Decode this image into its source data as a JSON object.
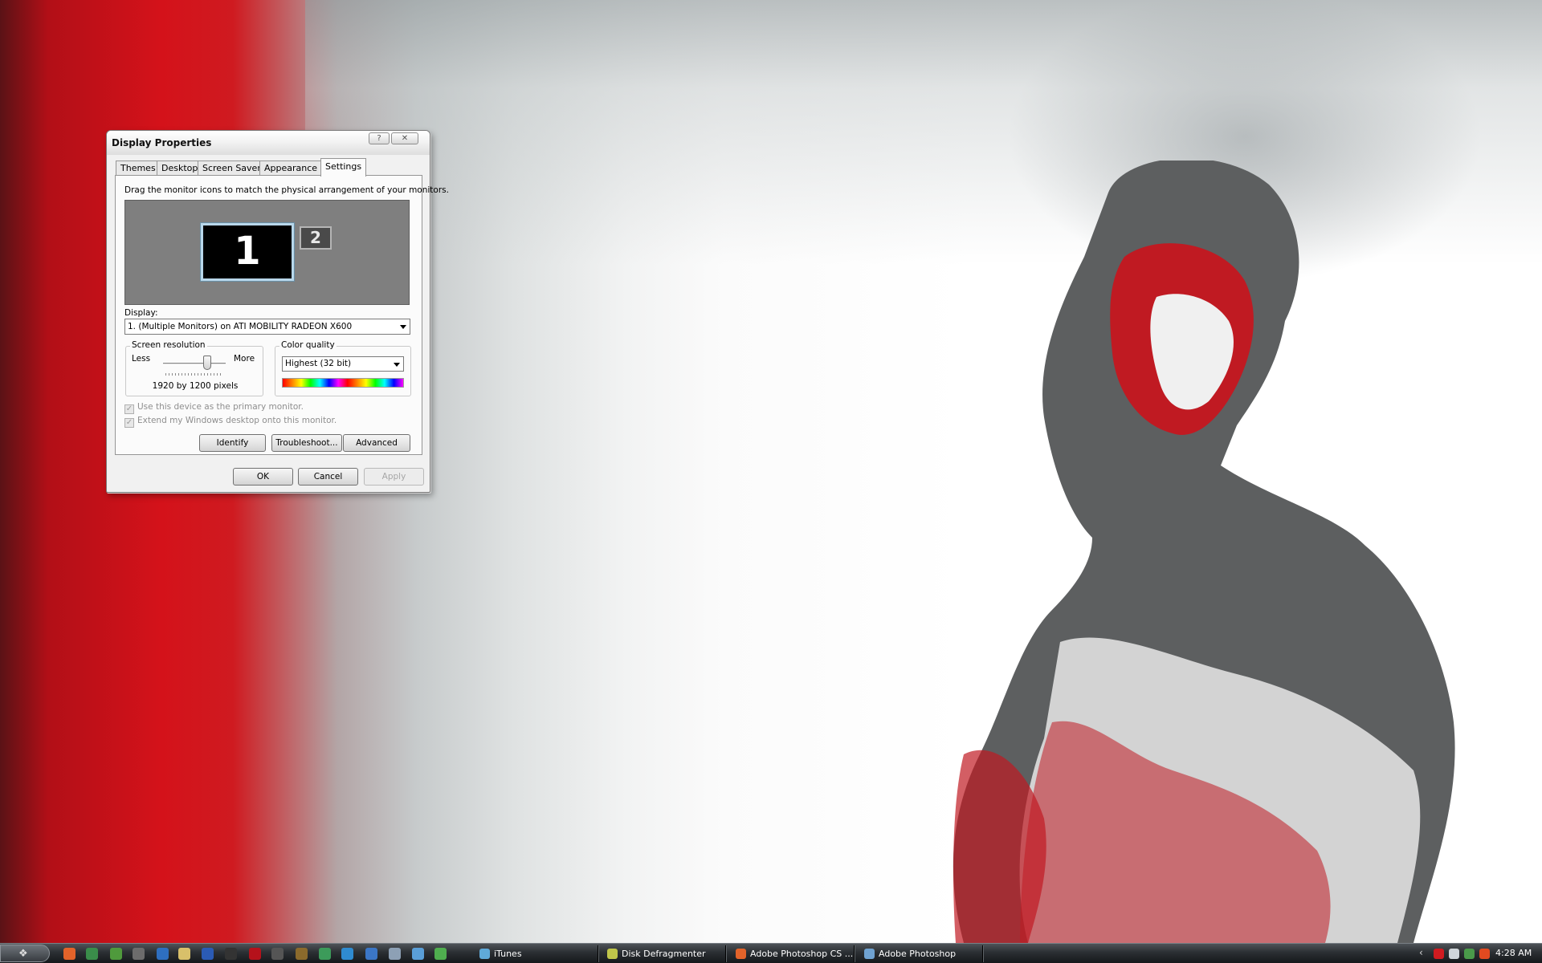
{
  "window": {
    "title": "Display Properties",
    "help_glyph": "?",
    "close_glyph": "✕"
  },
  "tabs": [
    "Themes",
    "Desktop",
    "Screen Saver",
    "Appearance",
    "Settings"
  ],
  "active_tab": "Settings",
  "settings": {
    "instruction": "Drag the monitor icons to match the physical arrangement of your monitors.",
    "monitor_1": "1",
    "monitor_2": "2",
    "display_label": "Display:",
    "display_value": "1. (Multiple Monitors) on ATI MOBILITY RADEON X600",
    "resolution_legend": "Screen resolution",
    "less_label": "Less",
    "more_label": "More",
    "resolution_value": "1920 by 1200 pixels",
    "color_legend": "Color quality",
    "color_value": "Highest (32 bit)",
    "primary_checkbox": "Use this device as the primary monitor.",
    "extend_checkbox": "Extend my Windows desktop onto this monitor.",
    "identify": "Identify",
    "troubleshoot": "Troubleshoot...",
    "advanced": "Advanced"
  },
  "footer": {
    "ok": "OK",
    "cancel": "Cancel",
    "apply": "Apply"
  },
  "taskbar": {
    "tasks": [
      "iTunes",
      "Disk Defragmenter",
      "Adobe Photoshop CS ...",
      "Adobe Photoshop"
    ],
    "clock": "4:28 AM"
  },
  "colors": {
    "accent_red": "#d4121a",
    "monitor_border": "#b8d7ea"
  }
}
